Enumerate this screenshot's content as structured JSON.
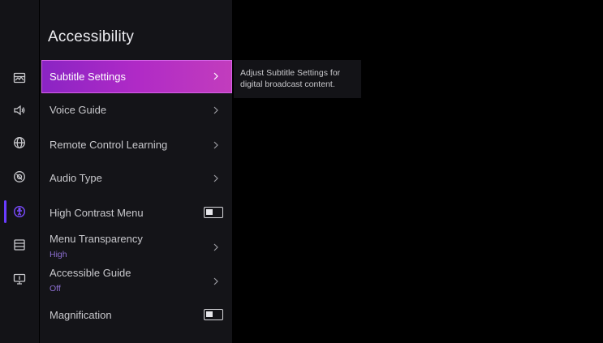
{
  "rail": {
    "icons": [
      "picture-icon",
      "sound-icon",
      "globe-icon",
      "general-icon",
      "accessibility-icon",
      "list-icon",
      "monitor-icon"
    ],
    "active_index": 4,
    "accent": "#6a3cff"
  },
  "panel": {
    "title": "Accessibility",
    "items": [
      {
        "label": "Subtitle Settings",
        "control": "chevron",
        "selected": true
      },
      {
        "label": "Voice Guide",
        "control": "chevron"
      },
      {
        "label": "Remote Control Learning",
        "control": "chevron"
      },
      {
        "label": "Audio Type",
        "control": "chevron"
      },
      {
        "label": "High Contrast Menu",
        "control": "toggle",
        "value": "off"
      },
      {
        "label": "Menu Transparency",
        "sub": "High",
        "control": "chevron"
      },
      {
        "label": "Accessible Guide",
        "sub": "Off",
        "control": "chevron"
      },
      {
        "label": "Magnification",
        "control": "toggle",
        "value": "off"
      }
    ]
  },
  "help": {
    "text": "Adjust Subtitle Settings for digital broadcast content."
  },
  "colors": {
    "selected_gradient_start": "#8a24c4",
    "selected_gradient_end": "#c23dbd",
    "subtext": "#8d6fd1"
  }
}
